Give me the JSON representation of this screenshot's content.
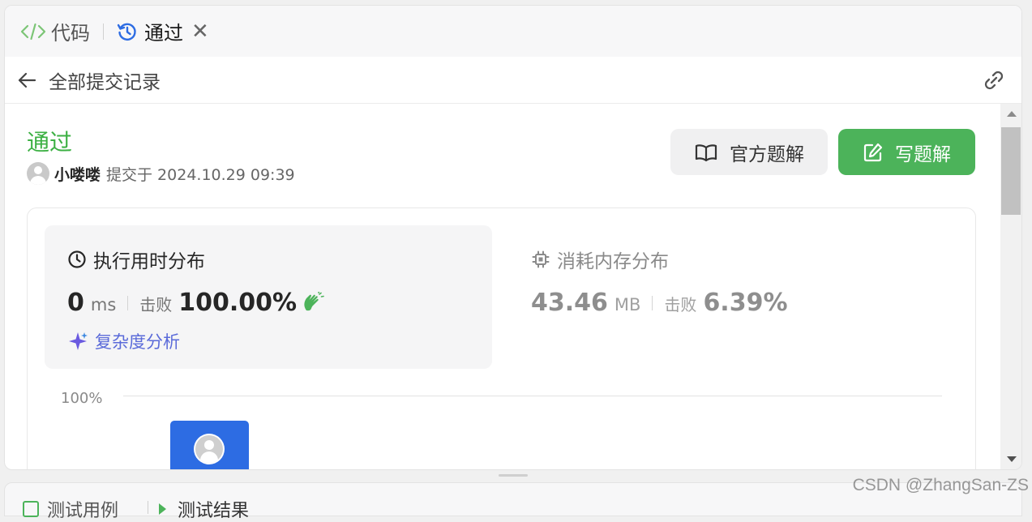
{
  "tabs": {
    "code": "代码",
    "result": "通过",
    "close": "✕"
  },
  "subheader": {
    "title": "全部提交记录"
  },
  "submission": {
    "status": "通过",
    "user": "小喽喽",
    "submitted_at": "提交于 2024.10.29 09:39",
    "status_color": "#3cb043"
  },
  "actions": {
    "official_solution": "官方题解",
    "write_solution": "写题解",
    "write_color": "#4cb35a"
  },
  "runtime": {
    "title": "执行用时分布",
    "value": "0",
    "unit": "ms",
    "beat_label": "击败",
    "beat": "100.00%",
    "complexity_link": "复杂度分析"
  },
  "memory": {
    "title": "消耗内存分布",
    "value": "43.46",
    "unit": "MB",
    "beat_label": "击败",
    "beat": "6.39%"
  },
  "distribution_chart": {
    "y_tick": "100%",
    "bar_color": "#2d6ce3"
  },
  "bottom_tabs": {
    "testcase": "测试用例",
    "test_result": "测试结果"
  },
  "watermark": "CSDN @ZhangSan-ZS"
}
